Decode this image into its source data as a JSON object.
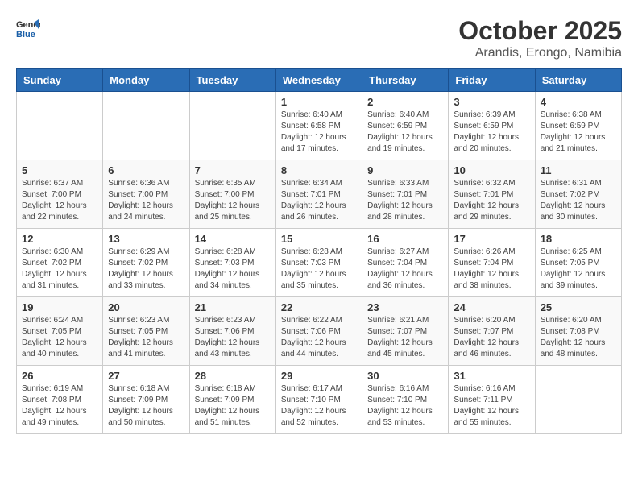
{
  "header": {
    "logo_line1": "General",
    "logo_line2": "Blue",
    "month": "October 2025",
    "location": "Arandis, Erongo, Namibia"
  },
  "days_of_week": [
    "Sunday",
    "Monday",
    "Tuesday",
    "Wednesday",
    "Thursday",
    "Friday",
    "Saturday"
  ],
  "weeks": [
    [
      {
        "day": "",
        "info": ""
      },
      {
        "day": "",
        "info": ""
      },
      {
        "day": "",
        "info": ""
      },
      {
        "day": "1",
        "info": "Sunrise: 6:40 AM\nSunset: 6:58 PM\nDaylight: 12 hours\nand 17 minutes."
      },
      {
        "day": "2",
        "info": "Sunrise: 6:40 AM\nSunset: 6:59 PM\nDaylight: 12 hours\nand 19 minutes."
      },
      {
        "day": "3",
        "info": "Sunrise: 6:39 AM\nSunset: 6:59 PM\nDaylight: 12 hours\nand 20 minutes."
      },
      {
        "day": "4",
        "info": "Sunrise: 6:38 AM\nSunset: 6:59 PM\nDaylight: 12 hours\nand 21 minutes."
      }
    ],
    [
      {
        "day": "5",
        "info": "Sunrise: 6:37 AM\nSunset: 7:00 PM\nDaylight: 12 hours\nand 22 minutes."
      },
      {
        "day": "6",
        "info": "Sunrise: 6:36 AM\nSunset: 7:00 PM\nDaylight: 12 hours\nand 24 minutes."
      },
      {
        "day": "7",
        "info": "Sunrise: 6:35 AM\nSunset: 7:00 PM\nDaylight: 12 hours\nand 25 minutes."
      },
      {
        "day": "8",
        "info": "Sunrise: 6:34 AM\nSunset: 7:01 PM\nDaylight: 12 hours\nand 26 minutes."
      },
      {
        "day": "9",
        "info": "Sunrise: 6:33 AM\nSunset: 7:01 PM\nDaylight: 12 hours\nand 28 minutes."
      },
      {
        "day": "10",
        "info": "Sunrise: 6:32 AM\nSunset: 7:01 PM\nDaylight: 12 hours\nand 29 minutes."
      },
      {
        "day": "11",
        "info": "Sunrise: 6:31 AM\nSunset: 7:02 PM\nDaylight: 12 hours\nand 30 minutes."
      }
    ],
    [
      {
        "day": "12",
        "info": "Sunrise: 6:30 AM\nSunset: 7:02 PM\nDaylight: 12 hours\nand 31 minutes."
      },
      {
        "day": "13",
        "info": "Sunrise: 6:29 AM\nSunset: 7:02 PM\nDaylight: 12 hours\nand 33 minutes."
      },
      {
        "day": "14",
        "info": "Sunrise: 6:28 AM\nSunset: 7:03 PM\nDaylight: 12 hours\nand 34 minutes."
      },
      {
        "day": "15",
        "info": "Sunrise: 6:28 AM\nSunset: 7:03 PM\nDaylight: 12 hours\nand 35 minutes."
      },
      {
        "day": "16",
        "info": "Sunrise: 6:27 AM\nSunset: 7:04 PM\nDaylight: 12 hours\nand 36 minutes."
      },
      {
        "day": "17",
        "info": "Sunrise: 6:26 AM\nSunset: 7:04 PM\nDaylight: 12 hours\nand 38 minutes."
      },
      {
        "day": "18",
        "info": "Sunrise: 6:25 AM\nSunset: 7:05 PM\nDaylight: 12 hours\nand 39 minutes."
      }
    ],
    [
      {
        "day": "19",
        "info": "Sunrise: 6:24 AM\nSunset: 7:05 PM\nDaylight: 12 hours\nand 40 minutes."
      },
      {
        "day": "20",
        "info": "Sunrise: 6:23 AM\nSunset: 7:05 PM\nDaylight: 12 hours\nand 41 minutes."
      },
      {
        "day": "21",
        "info": "Sunrise: 6:23 AM\nSunset: 7:06 PM\nDaylight: 12 hours\nand 43 minutes."
      },
      {
        "day": "22",
        "info": "Sunrise: 6:22 AM\nSunset: 7:06 PM\nDaylight: 12 hours\nand 44 minutes."
      },
      {
        "day": "23",
        "info": "Sunrise: 6:21 AM\nSunset: 7:07 PM\nDaylight: 12 hours\nand 45 minutes."
      },
      {
        "day": "24",
        "info": "Sunrise: 6:20 AM\nSunset: 7:07 PM\nDaylight: 12 hours\nand 46 minutes."
      },
      {
        "day": "25",
        "info": "Sunrise: 6:20 AM\nSunset: 7:08 PM\nDaylight: 12 hours\nand 48 minutes."
      }
    ],
    [
      {
        "day": "26",
        "info": "Sunrise: 6:19 AM\nSunset: 7:08 PM\nDaylight: 12 hours\nand 49 minutes."
      },
      {
        "day": "27",
        "info": "Sunrise: 6:18 AM\nSunset: 7:09 PM\nDaylight: 12 hours\nand 50 minutes."
      },
      {
        "day": "28",
        "info": "Sunrise: 6:18 AM\nSunset: 7:09 PM\nDaylight: 12 hours\nand 51 minutes."
      },
      {
        "day": "29",
        "info": "Sunrise: 6:17 AM\nSunset: 7:10 PM\nDaylight: 12 hours\nand 52 minutes."
      },
      {
        "day": "30",
        "info": "Sunrise: 6:16 AM\nSunset: 7:10 PM\nDaylight: 12 hours\nand 53 minutes."
      },
      {
        "day": "31",
        "info": "Sunrise: 6:16 AM\nSunset: 7:11 PM\nDaylight: 12 hours\nand 55 minutes."
      },
      {
        "day": "",
        "info": ""
      }
    ]
  ]
}
